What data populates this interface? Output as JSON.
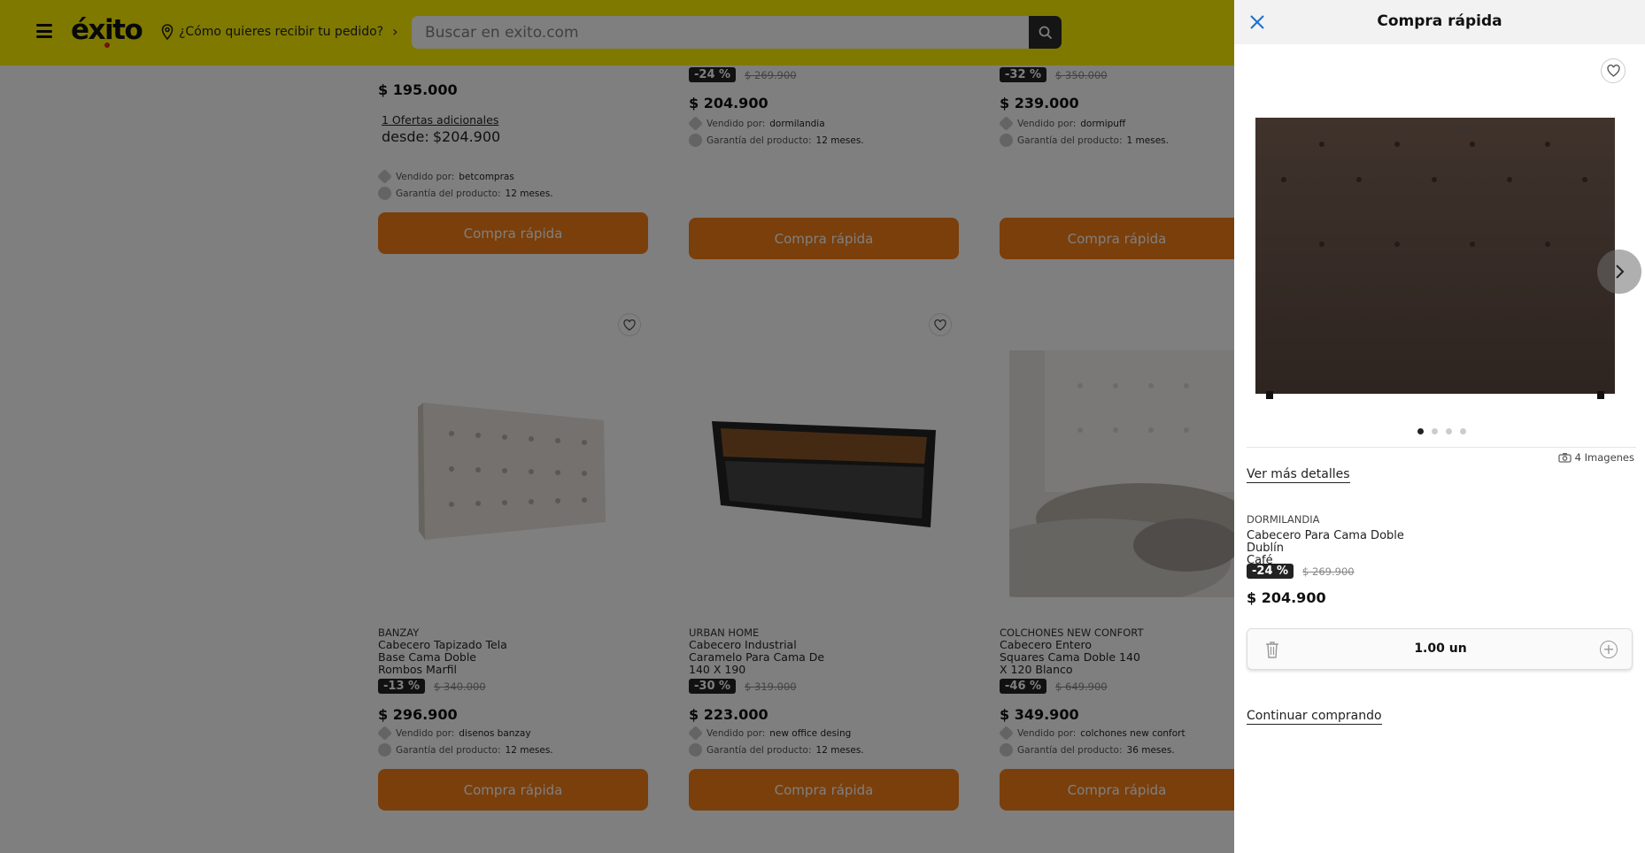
{
  "header": {
    "logo": "éxito",
    "delivery_prompt": "¿Cómo quieres recibir tu pedido?",
    "search_placeholder": "Buscar en exito.com"
  },
  "products": [
    {
      "brand": "",
      "name": [],
      "discount": "",
      "old_price": "",
      "price": "$ 195.000",
      "offers_link": "1 Ofertas adicionales",
      "from_label": "desde:",
      "from_price": "$204.900",
      "seller_label": "Vendido por:",
      "seller": "betcompras",
      "warranty_label": "Garantía del producto:",
      "warranty": "12 meses.",
      "button": "Compra rápida"
    },
    {
      "brand": "",
      "name": [],
      "discount": "-24 %",
      "old_price": "$ 269.900",
      "price": "$ 204.900",
      "seller_label": "Vendido por:",
      "seller": "dormilandia",
      "warranty_label": "Garantía del producto:",
      "warranty": "12 meses.",
      "button": "Compra rápida"
    },
    {
      "brand": "",
      "name": [],
      "discount": "-32 %",
      "old_price": "$ 350.000",
      "price": "$ 239.000",
      "seller_label": "Vendido por:",
      "seller": "dormipuff",
      "warranty_label": "Garantía del producto:",
      "warranty": "1 meses.",
      "button": "Compra rápida"
    },
    {
      "brand": "BANZAY",
      "name": [
        "Cabecero Tapizado Tela",
        "Base Cama Doble",
        "Rombos Marfil"
      ],
      "discount": "-13 %",
      "old_price": "$ 340.000",
      "price": "$ 296.900",
      "seller_label": "Vendido por:",
      "seller": "disenos banzay",
      "warranty_label": "Garantía del producto:",
      "warranty": "12 meses.",
      "button": "Compra rápida"
    },
    {
      "brand": "URBAN HOME",
      "name": [
        "Cabecero Industrial",
        "Caramelo Para Cama De",
        "140 X 190"
      ],
      "discount": "-30 %",
      "old_price": "$ 319.000",
      "price": "$ 223.000",
      "seller_label": "Vendido por:",
      "seller": "new office desing",
      "warranty_label": "Garantía del producto:",
      "warranty": "12 meses.",
      "button": "Compra rápida"
    },
    {
      "brand": "COLCHONES NEW CONFORT",
      "name": [
        "Cabecero Entero",
        "Squares Cama Doble 140",
        "X 120 Blanco"
      ],
      "discount": "-46 %",
      "old_price": "$ 649.900",
      "price": "$ 349.900",
      "seller_label": "Vendido por:",
      "seller": "colchones new confort",
      "warranty_label": "Garantía del producto:",
      "warranty": "36 meses.",
      "button": "Compra rápida"
    }
  ],
  "panel": {
    "title": "Compra rápida",
    "image_count": "4 Imagenes",
    "details_link": "Ver más detalles",
    "brand": "DORMILANDIA",
    "name_line1": "Cabecero Para Cama Doble Dublín",
    "name_line2": "Café",
    "discount": "-24 %",
    "old_price": "$ 269.900",
    "price": "$ 204.900",
    "quantity": "1.00 un",
    "continue_link": "Continuar comprando",
    "dots": 4,
    "active_dot": 1
  }
}
